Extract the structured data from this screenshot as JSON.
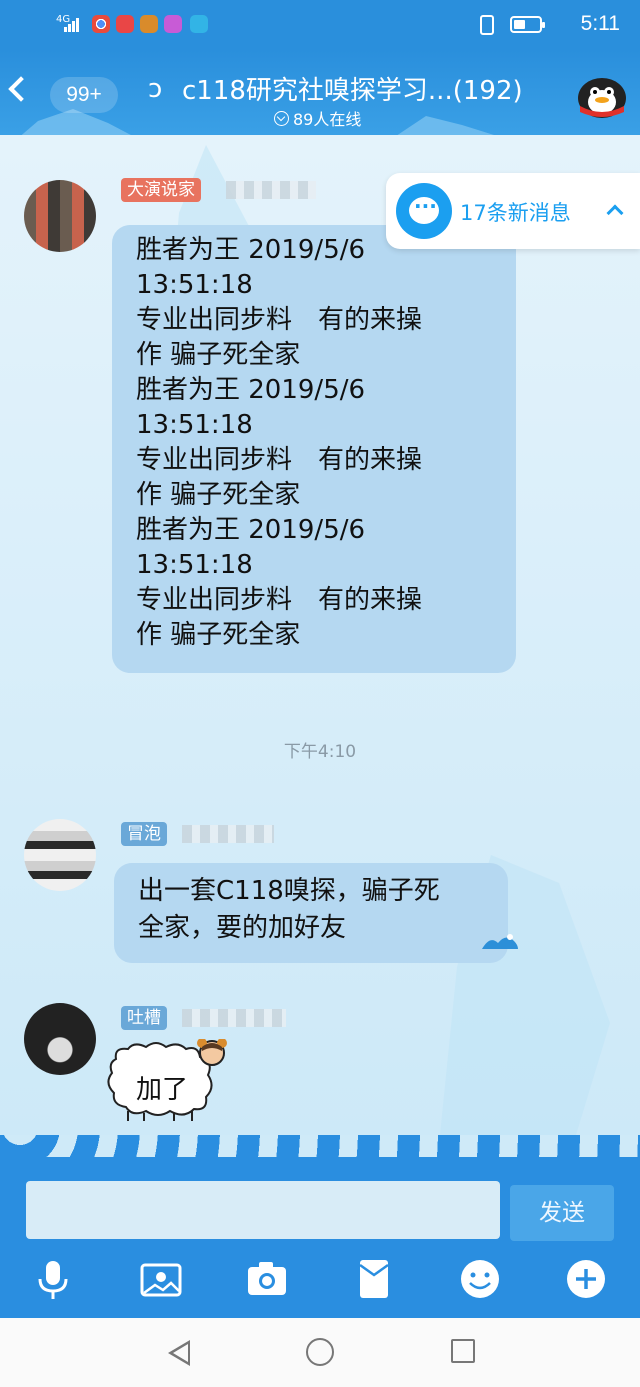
{
  "status_bar": {
    "network": "4G",
    "time": "5:11",
    "battery_level": 0.45
  },
  "header": {
    "back_badge": "99+",
    "title": "c118研究社嗅探学习...(192)",
    "online": "89人在线"
  },
  "new_messages": "17条新消息",
  "messages": [
    {
      "tag": "大演说家",
      "tag_color": "#e8735f",
      "lines": [
        "胜者为王 2019/5/6",
        "13:51:18",
        "专业出同步料　有的来操",
        "作  骗子死全家",
        "胜者为王 2019/5/6",
        "13:51:18",
        "专业出同步料　有的来操",
        "作  骗子死全家",
        "胜者为王 2019/5/6",
        "13:51:18",
        "专业出同步料　有的来操",
        "作  骗子死全家"
      ]
    },
    {
      "tag": "冒泡",
      "tag_color": "#6aa8d8",
      "lines": [
        "出一套C118嗅探，骗子死",
        "全家，要的加好友"
      ]
    },
    {
      "tag": "吐槽",
      "tag_color": "#6aa8d8",
      "lines": [
        "加了"
      ]
    }
  ],
  "time_separator": "下午4:10",
  "input": {
    "placeholder": "",
    "send_label": "发送"
  },
  "toolbar_icons": [
    "mic-icon",
    "image-icon",
    "camera-icon",
    "file-icon",
    "emoji-icon",
    "plus-icon"
  ]
}
